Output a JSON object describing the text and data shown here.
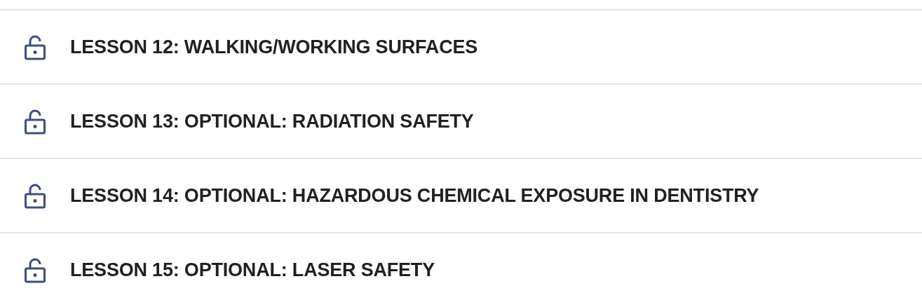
{
  "lessons": [
    {
      "title": "LESSON 12: WALKING/WORKING SURFACES",
      "locked": false
    },
    {
      "title": "LESSON 13: OPTIONAL: RADIATION SAFETY",
      "locked": false
    },
    {
      "title": "LESSON 14: OPTIONAL: HAZARDOUS CHEMICAL EXPOSURE IN DENTISTRY",
      "locked": false
    },
    {
      "title": "LESSON 15: OPTIONAL: LASER SAFETY",
      "locked": false
    }
  ]
}
